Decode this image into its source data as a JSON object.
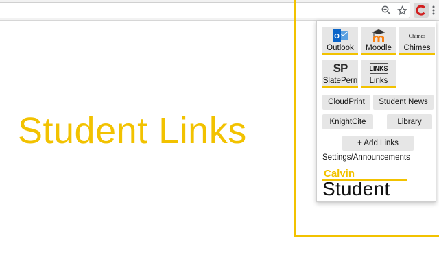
{
  "headline": "Student Links",
  "colors": {
    "accent": "#f2c200",
    "tile_bg": "#e6e6e6",
    "text": "#111111"
  },
  "toolbar": {
    "icons": [
      "zoom-icon",
      "star-icon",
      "calvin-extension-icon",
      "more-menu-icon"
    ]
  },
  "popup": {
    "tiles": [
      {
        "label": "Outlook",
        "icon": "outlook-icon"
      },
      {
        "label": "Moodle",
        "icon": "moodle-icon"
      },
      {
        "label": "Chimes",
        "icon": "chimes-icon",
        "logo_text": "Chimes"
      },
      {
        "label": "SlatePern",
        "icon": "slate-icon",
        "logo_text": "SP"
      },
      {
        "label": "Links",
        "icon": "links-icon",
        "logo_text": "LINKS"
      }
    ],
    "buttons": {
      "cloudprint": "CloudPrint",
      "student_news": "Student News",
      "knightcite": "KnightCite",
      "library": "Library",
      "add_links": "+ Add Links"
    },
    "settings_link": "Settings/Announcements",
    "branding": {
      "top": "Calvin",
      "bottom": "Student"
    }
  }
}
